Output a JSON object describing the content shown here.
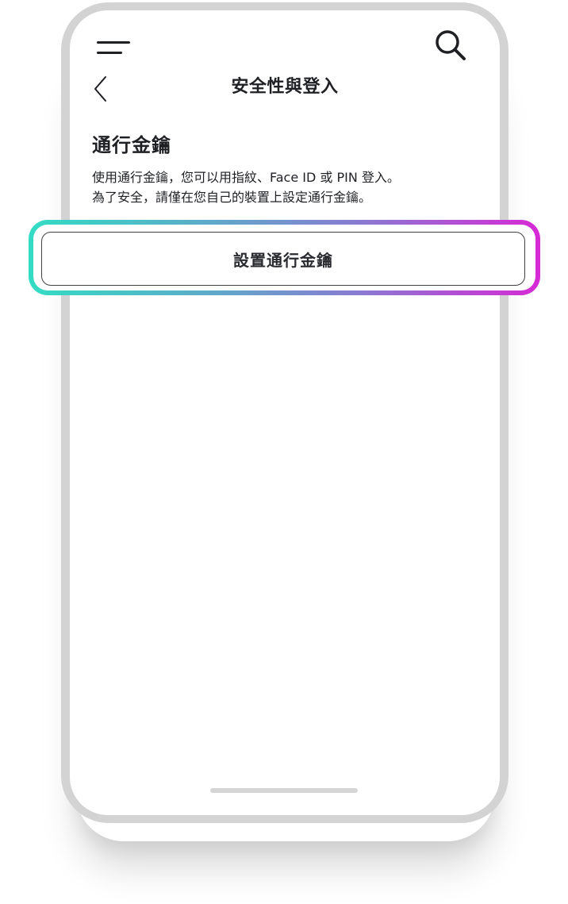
{
  "header": {
    "title": "安全性與登入",
    "menu_icon": "menu-icon",
    "search_icon": "search-icon",
    "back_icon": "chevron-left-icon"
  },
  "passkey": {
    "heading": "通行金鑰",
    "description_line_1": "使用通行金鑰，您可以用指紋、Face ID 或 PIN 登入。",
    "description_line_2": "為了安全，請僅在您自己的裝置上設定通行金鑰。",
    "button_label": "設置通行金鑰"
  },
  "colors": {
    "highlight_gradient_start": "#33dcc4",
    "highlight_gradient_end": "#d629d4",
    "text_primary": "#1f2024"
  }
}
